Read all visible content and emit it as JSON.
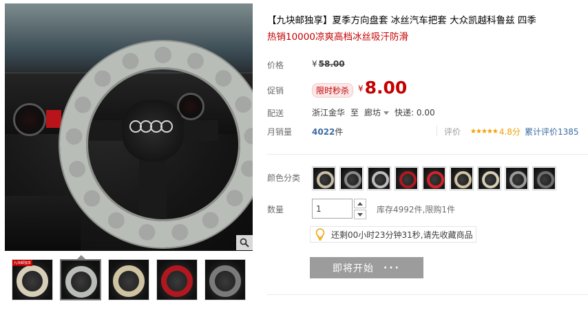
{
  "product": {
    "title": "【九块邮独享】夏季方向盘套 冰丝汽车把套 大众凯越科鲁兹 四季",
    "subtitle": "热销10000凉爽高档冰丝吸汗防滑"
  },
  "labels": {
    "price": "价格",
    "promo": "促销",
    "shipping": "配送",
    "monthly_sales": "月销量",
    "rating": "评价",
    "color": "颜色分类",
    "quantity": "数量"
  },
  "price": {
    "currency": "¥",
    "original": "58.00",
    "promo_tag": "限时秒杀",
    "promo": "8.00"
  },
  "shipping": {
    "from": "浙江金华",
    "to_word": "至",
    "to": "廊坊",
    "express": "快递: 0.00"
  },
  "sales": {
    "count": "4022",
    "unit": "件"
  },
  "rating": {
    "stars": "★★★★★",
    "score": "4.8分",
    "cumulative": "累计评价1385"
  },
  "colors": {
    "swatch_ring_colors": [
      "#c8bda6",
      "#8a8a8a",
      "#bdbdbd",
      "#b01820",
      "#d2232a",
      "#cfc3a2",
      "#d7cfb5",
      "#9a9a9a",
      "#6e6e6e"
    ]
  },
  "quantity": {
    "value": "1",
    "stock": "库存4992件,限购1件"
  },
  "countdown": {
    "text": "还剩00小时23分钟31秒,请先收藏商品"
  },
  "button": {
    "label": "即将开始",
    "dots": "···"
  },
  "gallery": {
    "thumb_badge": "九块邮独享",
    "thumb_count": 5,
    "active_index": 1
  },
  "icons": {
    "zoom": "magnifier-icon",
    "bulb": "lightbulb-icon"
  },
  "accent": "#c40000",
  "link_color": "#3c6ba3"
}
